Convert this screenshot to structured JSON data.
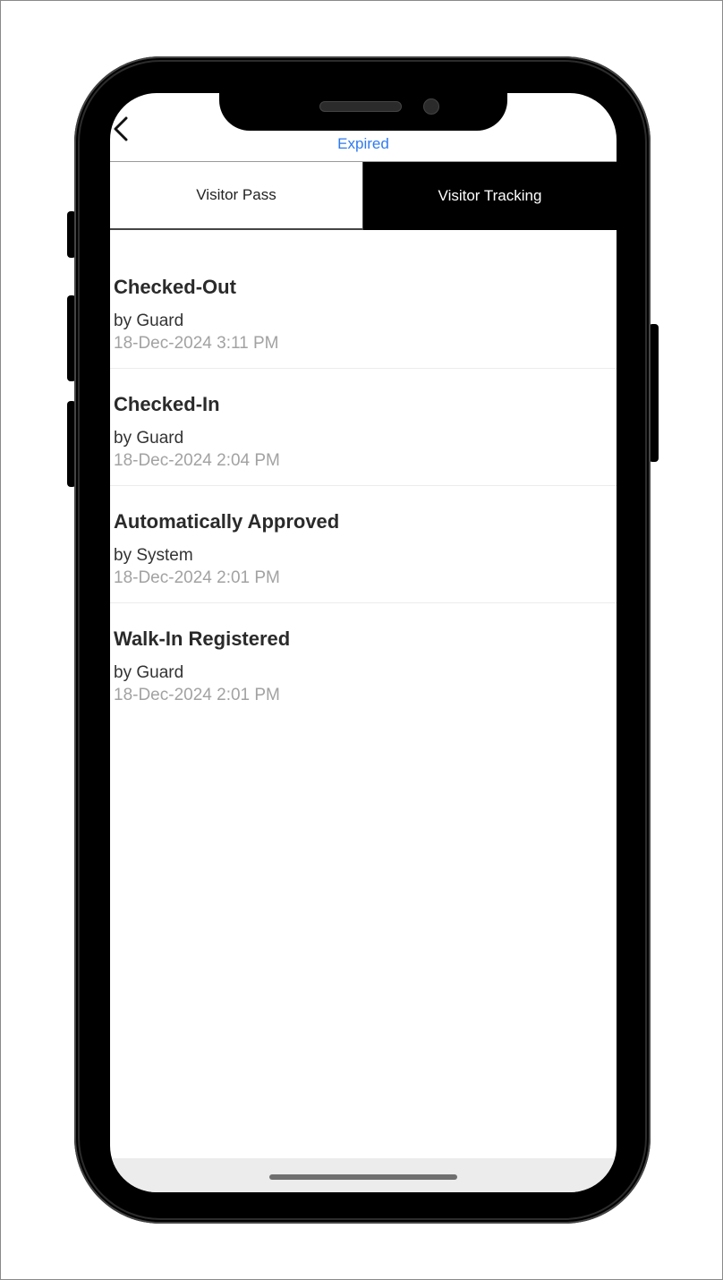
{
  "header": {
    "status": "Expired"
  },
  "tabs": [
    {
      "label": "Visitor Pass",
      "active": false
    },
    {
      "label": "Visitor Tracking",
      "active": true
    }
  ],
  "events": [
    {
      "title": "Checked-Out",
      "by": "by Guard",
      "time": "18-Dec-2024 3:11 PM"
    },
    {
      "title": "Checked-In",
      "by": "by Guard",
      "time": "18-Dec-2024 2:04 PM"
    },
    {
      "title": "Automatically Approved",
      "by": "by System",
      "time": "18-Dec-2024 2:01 PM"
    },
    {
      "title": "Walk-In Registered",
      "by": "by Guard",
      "time": "18-Dec-2024 2:01 PM"
    }
  ],
  "colors": {
    "status_text": "#2f7bf0",
    "active_tab_bg": "#000000",
    "timestamp": "#a2a2a2"
  },
  "icons": {
    "back": "chevron-left-icon"
  }
}
